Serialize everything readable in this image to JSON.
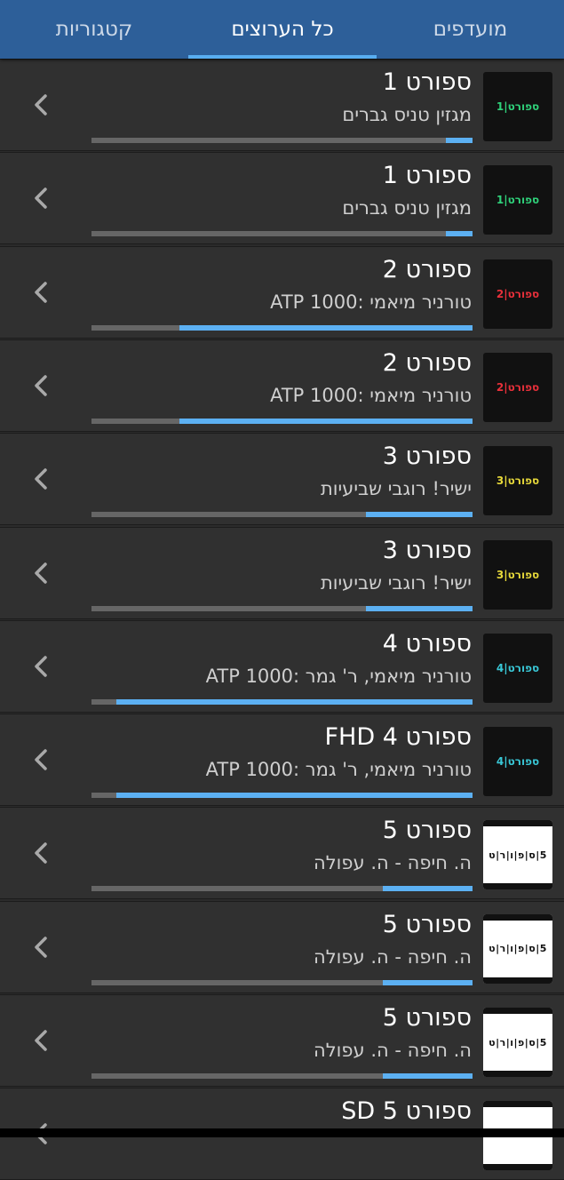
{
  "tabs": [
    {
      "label": "מועדפים",
      "active": false
    },
    {
      "label": "כל הערוצים",
      "active": true
    },
    {
      "label": "קטגוריות",
      "active": false
    }
  ],
  "colors": {
    "tabbar": "#2d5f99",
    "indicator": "#58adf0",
    "progress_fill": "#5cb0f2",
    "progress_track": "#666666",
    "row_bg": "#303030"
  },
  "channels": [
    {
      "title": "ספורט 1",
      "subtitle": "מגזין טניס גברים",
      "progress": 0.07,
      "logo": {
        "text": "ספורט|1",
        "color": "#2fd17a",
        "style": "dark"
      }
    },
    {
      "title": "ספורט 1",
      "subtitle": "מגזין טניס גברים",
      "progress": 0.07,
      "logo": {
        "text": "ספורט|1",
        "color": "#2fd17a",
        "style": "dark"
      }
    },
    {
      "title": "ספורט 2",
      "subtitle": "טורניר מיאמי :ATP 1000",
      "progress": 0.77,
      "logo": {
        "text": "ספורט|2",
        "color": "#e8303a",
        "style": "dark"
      }
    },
    {
      "title": "ספורט 2",
      "subtitle": "טורניר מיאמי :ATP 1000",
      "progress": 0.77,
      "logo": {
        "text": "ספורט|2",
        "color": "#e8303a",
        "style": "dark"
      }
    },
    {
      "title": "ספורט 3",
      "subtitle": "ישיר! רוגבי שביעיות",
      "progress": 0.28,
      "logo": {
        "text": "ספורט|3",
        "color": "#e6d83a",
        "style": "dark"
      }
    },
    {
      "title": "ספורט 3",
      "subtitle": "ישיר! רוגבי שביעיות",
      "progress": 0.28,
      "logo": {
        "text": "ספורט|3",
        "color": "#e6d83a",
        "style": "dark"
      }
    },
    {
      "title": "ספורט 4",
      "subtitle": "טורניר מיאמי, ר' גמר :ATP 1000",
      "progress": 0.935,
      "logo": {
        "text": "ספורט|4",
        "color": "#39c7d6",
        "style": "dark"
      }
    },
    {
      "title": "ספורט FHD 4",
      "subtitle": "טורניר מיאמי, ר' גמר :ATP 1000",
      "progress": 0.935,
      "logo": {
        "text": "ספורט|4",
        "color": "#39c7d6",
        "style": "dark"
      }
    },
    {
      "title": "ספורט 5",
      "subtitle": "ה. חיפה - ה. עפולה",
      "progress": 0.235,
      "logo": {
        "text": "5|ס|פ|ו|ר|ט",
        "color": "#111111",
        "style": "white"
      }
    },
    {
      "title": "ספורט 5",
      "subtitle": "ה. חיפה - ה. עפולה",
      "progress": 0.235,
      "logo": {
        "text": "5|ס|פ|ו|ר|ט",
        "color": "#111111",
        "style": "white"
      }
    },
    {
      "title": "ספורט 5",
      "subtitle": "ה. חיפה - ה. עפולה",
      "progress": 0.235,
      "logo": {
        "text": "5|ס|פ|ו|ר|ט",
        "color": "#111111",
        "style": "white"
      }
    },
    {
      "title": "ספורט 5 SD",
      "subtitle": "",
      "progress": 0,
      "logo": {
        "text": "",
        "color": "#111111",
        "style": "white"
      }
    }
  ],
  "icons": {
    "row_action": "chevron-left-icon"
  }
}
